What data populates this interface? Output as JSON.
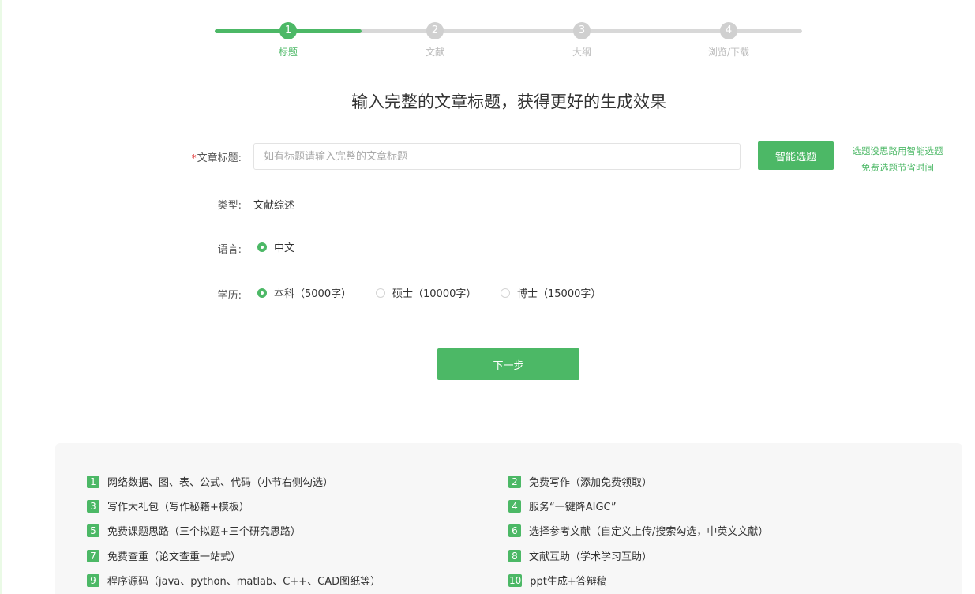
{
  "stepper": {
    "progress": 0.25,
    "steps": [
      {
        "number": "1",
        "label": "标题",
        "active": true
      },
      {
        "number": "2",
        "label": "文献",
        "active": false
      },
      {
        "number": "3",
        "label": "大纲",
        "active": false
      },
      {
        "number": "4",
        "label": "浏览/下载",
        "active": false
      }
    ]
  },
  "page_title": "输入完整的文章标题，获得更好的生成效果",
  "form": {
    "title_label": "文章标题:",
    "required_mark": "*",
    "title_placeholder": "如有标题请输入完整的文章标题",
    "title_value": "",
    "smart_button": "智能选题",
    "hint_line1": "选题没思路用智能选题",
    "hint_line2": "免费选题节省时间",
    "type_label": "类型:",
    "type_value": "文献综述",
    "language_label": "语言:",
    "language_option": "中文",
    "degree_label": "学历:",
    "degree_options": [
      {
        "label": "本科（5000字）",
        "checked": true
      },
      {
        "label": "硕士（10000字）",
        "checked": false
      },
      {
        "label": "博士（15000字）",
        "checked": false
      }
    ],
    "next_button": "下一步"
  },
  "features": [
    {
      "num": "1",
      "text": "网络数据、图、表、公式、代码（小节右侧勾选）"
    },
    {
      "num": "2",
      "text": "免费写作（添加免费领取）"
    },
    {
      "num": "3",
      "text": "写作大礼包（写作秘籍+模板）"
    },
    {
      "num": "4",
      "text": "服务“一键降AIGC”"
    },
    {
      "num": "5",
      "text": "免费课题思路（三个拟题+三个研究思路）"
    },
    {
      "num": "6",
      "text": "选择参考文献（自定义上传/搜索勾选，中英文文献）"
    },
    {
      "num": "7",
      "text": "免费查重（论文查重一站式）"
    },
    {
      "num": "8",
      "text": "文献互助（学术学习互助）"
    },
    {
      "num": "9",
      "text": "程序源码（java、python、matlab、C++、CAD图纸等）"
    },
    {
      "num": "10",
      "text": "ppt生成+答辩稿"
    }
  ],
  "colors": {
    "accent": "#4cb866",
    "required": "#e23b3b",
    "inactive": "#d0d0d0"
  }
}
